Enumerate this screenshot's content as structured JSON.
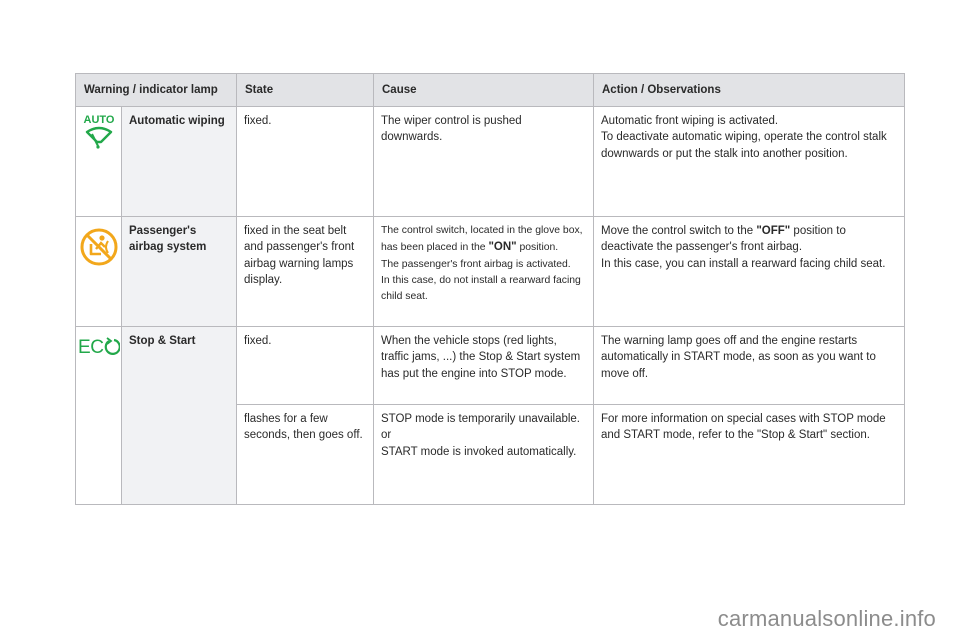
{
  "table": {
    "headers": [
      "Warning / indicator lamp",
      "State",
      "Cause",
      "Action / Observations"
    ],
    "rows": [
      {
        "icon": "auto-wiping-icon",
        "icon_text": "AUTO",
        "icon_color": "#22a84a",
        "name": "Automatic wiping",
        "entries": [
          {
            "state": "fixed.",
            "cause": [
              "The wiper control is pushed downwards."
            ],
            "action": [
              "Automatic front wiping is activated.",
              "To deactivate automatic wiping, operate the control stalk downwards or put the stalk into another position."
            ]
          }
        ]
      },
      {
        "icon": "passenger-airbag-off-icon",
        "icon_color": "#f2a71b",
        "name": "Passenger's airbag system",
        "entries": [
          {
            "state": "fixed in the seat belt and passenger's front airbag warning lamps display.",
            "cause_pre": "The control switch, located in the glove box, has been placed in the ",
            "cause_bold": "\"ON\"",
            "cause_post": " position.",
            "cause_line2": "The passenger's front airbag is activated.",
            "cause_line3": "In this case, do not install a rearward facing child seat.",
            "action_pre": "Move the control switch to the ",
            "action_bold": "\"OFF\"",
            "action_post": " position to deactivate the passenger's front airbag.",
            "action_line2": "In this case, you can install a rearward facing child seat."
          }
        ]
      },
      {
        "icon": "eco-stop-start-icon",
        "icon_text": "ECO",
        "icon_color": "#22a84a",
        "name": "Stop & Start",
        "entries": [
          {
            "state": "fixed.",
            "cause": [
              "When the vehicle stops (red lights, traffic jams, ...) the Stop & Start system has put the engine into STOP mode."
            ],
            "action": [
              "The warning lamp goes off and the engine restarts automatically in START mode, as soon as you want to move off."
            ]
          },
          {
            "state": "flashes for a few seconds, then goes off.",
            "cause": [
              "STOP mode is temporarily unavailable.",
              "or",
              "START mode is invoked automatically."
            ],
            "action": [
              "For more information on special cases with STOP mode and START mode, refer to the \"Stop & Start\" section."
            ]
          }
        ]
      }
    ]
  },
  "watermark": "carmanualsonline.info"
}
